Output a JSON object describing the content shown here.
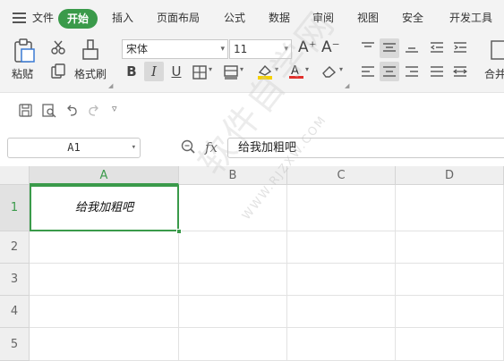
{
  "menubar": {
    "file": "文件",
    "tabs": [
      "开始",
      "插入",
      "页面布局",
      "公式",
      "数据",
      "审阅",
      "视图",
      "安全",
      "开发工具"
    ],
    "active_tab": "开始"
  },
  "ribbon": {
    "paste_label": "粘贴",
    "format_painter_label": "格式刷",
    "font_name": "宋体",
    "font_size": "11",
    "grow_font": "A⁺",
    "shrink_font": "A⁻",
    "bold": "B",
    "italic": "I",
    "underline": "U",
    "merge_label": "合并"
  },
  "formula_bar": {
    "name_box": "A1",
    "fx": "fx",
    "content": "给我加粗吧"
  },
  "sheet": {
    "columns": [
      "A",
      "B",
      "C",
      "D"
    ],
    "rows": [
      "1",
      "2",
      "3",
      "4",
      "5"
    ],
    "active_cell": "A1",
    "a1_value": "给我加粗吧"
  },
  "watermark": {
    "text": "软件自学网",
    "url": "WWW.RJZXW.COM"
  },
  "colors": {
    "accent": "#3a9a4a",
    "ribbon_bg": "#f3f3f3",
    "header_bg": "#efefef",
    "font_color_bar": "#e0302b",
    "highlight_bar": "#f5d000"
  }
}
